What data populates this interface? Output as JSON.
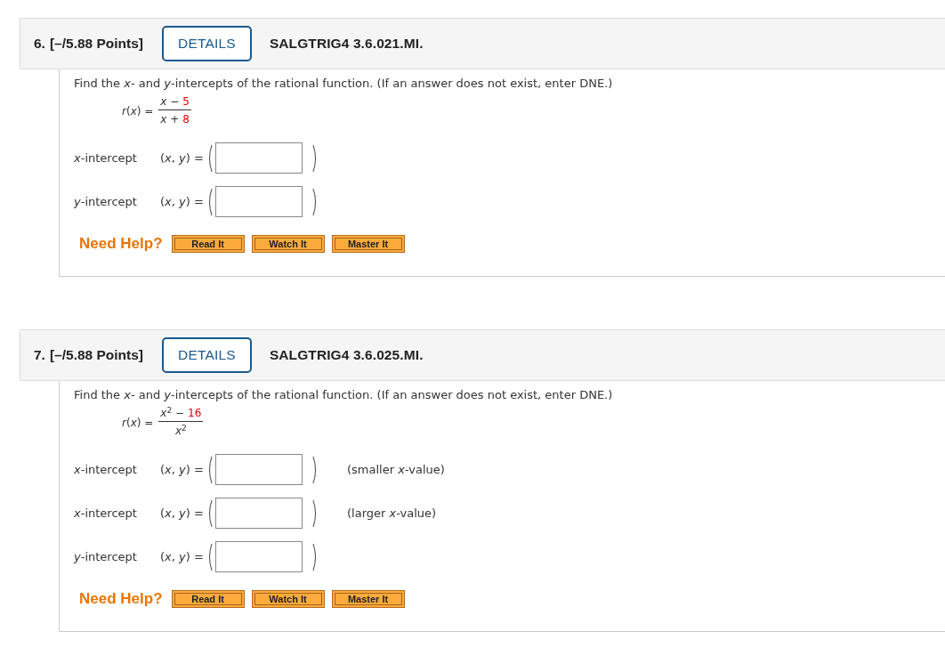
{
  "questions": [
    {
      "number": "6.",
      "points": "[–/5.88 Points]",
      "details_button": "DETAILS",
      "item_id": "SALGTRIG4 3.6.021.MI.",
      "prompt": "Find the *x*- and *y*-intercepts of the rational function. (If an answer does not exist, enter DNE.)",
      "function_label": "*r*(*x*) =",
      "numerator": [
        {
          "kind": "variable",
          "text": "*x* −"
        },
        {
          "kind": "given",
          "text": "5"
        }
      ],
      "denominator": [
        {
          "kind": "variable",
          "text": "*x* +"
        },
        {
          "kind": "given",
          "text": "8"
        }
      ],
      "answers": [
        {
          "label": "*x*-intercept",
          "expression": "(*x*, *y*) ="
        },
        {
          "label": "*y*-intercept",
          "expression": "(*x*, *y*) ="
        }
      ],
      "help_label": "Need Help?",
      "help_buttons": [
        "Read It",
        "Watch It",
        "Master It"
      ]
    },
    {
      "number": "7.",
      "points": "[–/5.88 Points]",
      "details_button": "DETAILS",
      "item_id": "SALGTRIG4 3.6.025.MI.",
      "prompt": "Find the *x*- and *y*-intercepts of the rational function. (If an answer does not exist, enter DNE.)",
      "function_label": "*r*(*x*) =",
      "numerator": [
        {
          "kind": "variable",
          "text": "*x*$^{2}$ −"
        },
        {
          "kind": "given",
          "text": "16"
        }
      ],
      "denominator": [
        {
          "kind": "variable",
          "text": "*x*$^{2}$"
        }
      ],
      "answers": [
        {
          "label": "*x*-intercept",
          "expression": "(*x*, *y*) =",
          "hint": "(smaller *x*-value)"
        },
        {
          "label": "*x*-intercept",
          "expression": "(*x*, *y*) =",
          "hint": "(larger *x*-value)"
        },
        {
          "label": "*y*-intercept",
          "expression": "(*x*, *y*) ="
        }
      ],
      "help_label": "Need Help?",
      "help_buttons": [
        "Read It",
        "Watch It",
        "Master It"
      ]
    }
  ]
}
